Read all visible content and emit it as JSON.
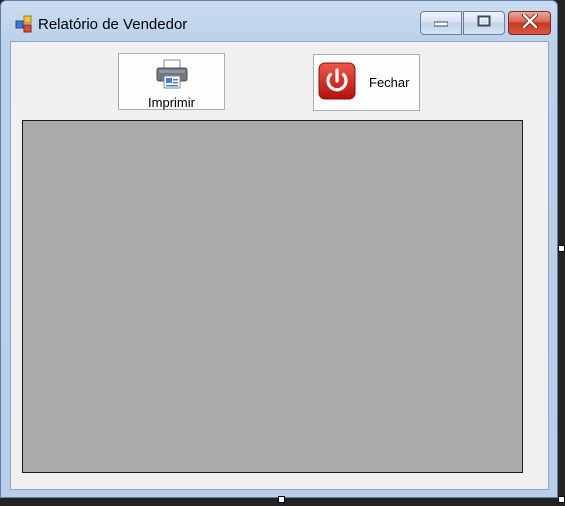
{
  "window": {
    "title": "Relatório de Vendedor",
    "app_icon": "form-app-icon",
    "controls": {
      "minimize_icon": "minimize-icon",
      "maximize_icon": "maximize-icon",
      "close_icon": "close-icon"
    }
  },
  "toolbar": {
    "print_label": "Imprimir",
    "print_icon": "printer-icon",
    "close_label": "Fechar",
    "close_icon": "power-icon"
  },
  "report_viewer": {
    "background_color": "#ababab"
  },
  "colors": {
    "close_accent": "#d0402a",
    "power_red": "#d8201a"
  }
}
